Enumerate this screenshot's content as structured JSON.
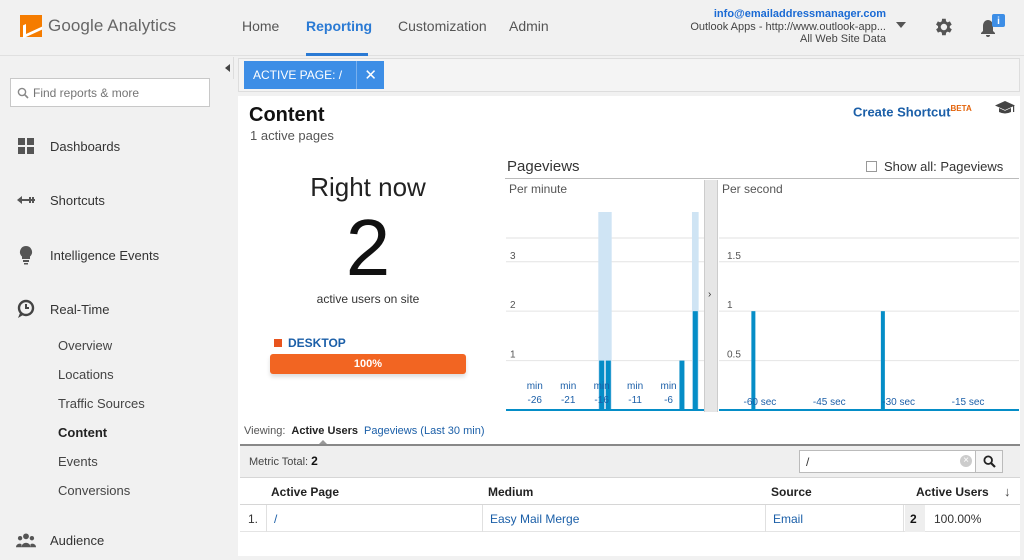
{
  "app": {
    "logo_text": "Google Analytics"
  },
  "nav": {
    "home": "Home",
    "reporting": "Reporting",
    "customization": "Customization",
    "admin": "Admin"
  },
  "account": {
    "email": "info@emailaddressmanager.com",
    "property": "Outlook Apps - http://www.outlook-app...",
    "view": "All Web Site Data"
  },
  "notifications": {
    "badge": "i"
  },
  "sidebar": {
    "search_placeholder": "Find reports & more",
    "items": [
      {
        "label": "Dashboards",
        "icon": "grid-icon"
      },
      {
        "label": "Shortcuts",
        "icon": "shortcut-arrow-icon"
      },
      {
        "label": "Intelligence Events",
        "icon": "lightbulb-icon"
      },
      {
        "label": "Real-Time",
        "icon": "clock-icon"
      },
      {
        "label": "Audience",
        "icon": "people-icon"
      }
    ],
    "realtime_sub": [
      {
        "label": "Overview",
        "active": false
      },
      {
        "label": "Locations",
        "active": false
      },
      {
        "label": "Traffic Sources",
        "active": false
      },
      {
        "label": "Content",
        "active": true
      },
      {
        "label": "Events",
        "active": false
      },
      {
        "label": "Conversions",
        "active": false
      }
    ]
  },
  "filter": {
    "chip_label": "ACTIVE PAGE: /",
    "close": "✕"
  },
  "content": {
    "title": "Content",
    "subtitle": "1 active pages",
    "shortcut": "Create Shortcut",
    "shortcut_badge": "BETA"
  },
  "rightnow": {
    "heading": "Right now",
    "count": "2",
    "label": "active users on site",
    "device": "DESKTOP",
    "device_pct": "100%",
    "device_share": 1.0
  },
  "pageviews": {
    "title": "Pageviews",
    "show_all": "Show all: Pageviews"
  },
  "chart_data": [
    {
      "type": "bar",
      "title": "Per minute",
      "x_ticks": [
        "-26",
        "-21",
        "-16",
        "-11",
        "-6"
      ],
      "x_tick_unit": "min",
      "y_ticks": [
        1,
        2,
        3
      ],
      "ylim": [
        0,
        3.4
      ],
      "x_range": [
        -30,
        -1
      ],
      "bars": [
        {
          "x": -16,
          "value": 1
        },
        {
          "x": -15,
          "value": 1
        },
        {
          "x": -4,
          "value": 1
        },
        {
          "x": -2,
          "value": 2
        }
      ],
      "color": "#058dc7",
      "highlight_color": "#cfe4f4"
    },
    {
      "type": "bar",
      "title": "Per second",
      "x_ticks": [
        "-60 sec",
        "-45 sec",
        "-30 sec",
        "-15 sec"
      ],
      "y_ticks": [
        0.5,
        1,
        1.5
      ],
      "ylim": [
        0,
        1.7
      ],
      "x_range": [
        -64,
        0
      ],
      "bars": [
        {
          "x": -57,
          "value": 1
        },
        {
          "x": -29,
          "value": 1
        }
      ],
      "color": "#058dc7"
    }
  ],
  "viewing": {
    "label": "Viewing:",
    "current": "Active Users",
    "alt": "Pageviews (Last 30 min)"
  },
  "table": {
    "metric_label": "Metric Total:",
    "metric_value": "2",
    "search_value": "/",
    "headers": [
      "Active Page",
      "Medium",
      "Source",
      "Active Users"
    ],
    "rows": [
      {
        "index": "1.",
        "page": "/",
        "medium": "Easy Mail Merge",
        "source": "Email",
        "users": "2",
        "pct": "100.00%"
      }
    ]
  },
  "colors": {
    "accent": "#2a7ad4",
    "chip": "#3d8ee6",
    "bar": "#f26522",
    "chart": "#058dc7"
  }
}
